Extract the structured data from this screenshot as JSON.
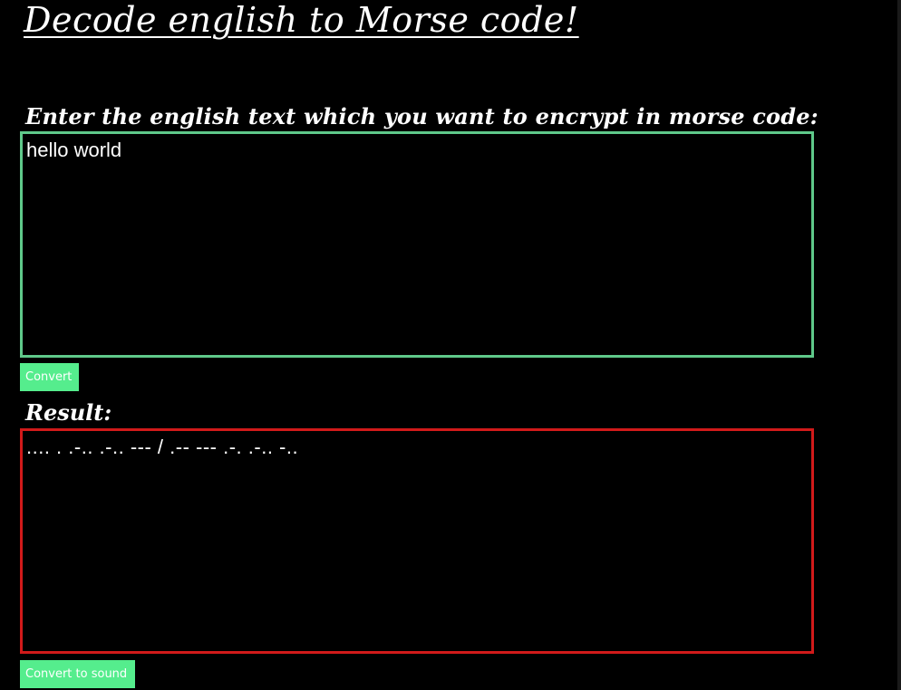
{
  "page": {
    "title": "Decode english to Morse code!"
  },
  "input_section": {
    "label": "Enter the english text which you want to encrypt in morse code:",
    "value": "hello world",
    "border_color": "#5fc98a"
  },
  "convert_button": {
    "label": "Convert",
    "color": "#55ed8d"
  },
  "result_section": {
    "label": "Result:",
    "value": ".... . .-.. .-.. --- / .-- --- .-. .-.. -..",
    "border_color": "#d11a1a"
  },
  "sound_button": {
    "label": "Convert to sound",
    "color": "#55ed8d"
  }
}
